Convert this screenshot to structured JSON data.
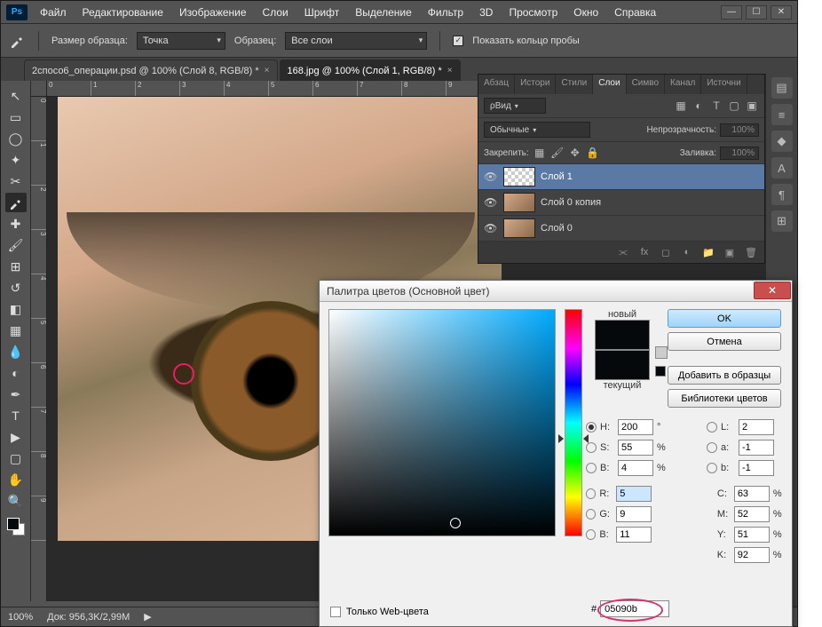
{
  "menu": [
    "Файл",
    "Редактирование",
    "Изображение",
    "Слои",
    "Шрифт",
    "Выделение",
    "Фильтр",
    "3D",
    "Просмотр",
    "Окно",
    "Справка"
  ],
  "options": {
    "sample_size_label": "Размер образца:",
    "sample_size_value": "Точка",
    "sample_label": "Образец:",
    "sample_value": "Все слои",
    "show_ring": "Показать кольцо пробы"
  },
  "tabs": [
    {
      "label": "2спосо6_операции.psd @ 100% (Слой 8, RGB/8) *",
      "active": false
    },
    {
      "label": "168.jpg @ 100% (Слой 1, RGB/8) *",
      "active": true
    }
  ],
  "layers_panel": {
    "tabs": [
      "Абзац",
      "Истори",
      "Стили",
      "Слои",
      "Симво",
      "Канал",
      "Источни"
    ],
    "active_tab": "Слои",
    "kind_label": "Вид",
    "blend_mode": "Обычные",
    "opacity_label": "Непрозрачность:",
    "opacity_value": "100%",
    "lock_label": "Закрепить:",
    "fill_label": "Заливка:",
    "fill_value": "100%",
    "layers": [
      {
        "name": "Слой 1",
        "selected": true,
        "checker": true
      },
      {
        "name": "Слой 0 копия",
        "selected": false,
        "checker": false
      },
      {
        "name": "Слой 0",
        "selected": false,
        "checker": false
      }
    ]
  },
  "status": {
    "zoom": "100%",
    "doc": "Док: 956,3K/2,99M"
  },
  "dialog": {
    "title": "Палитра цветов (Основной цвет)",
    "new_label": "новый",
    "current_label": "текущий",
    "ok": "OK",
    "cancel": "Отмена",
    "add": "Добавить в образцы",
    "lib": "Библиотеки цветов",
    "web_only": "Только Web-цвета",
    "hex": "05090b",
    "H": "200",
    "S": "55",
    "B": "4",
    "R": "5",
    "G": "9",
    "Bb": "11",
    "L": "2",
    "a": "-1",
    "b": "-1",
    "C": "63",
    "M": "52",
    "Y": "51",
    "K": "92"
  }
}
